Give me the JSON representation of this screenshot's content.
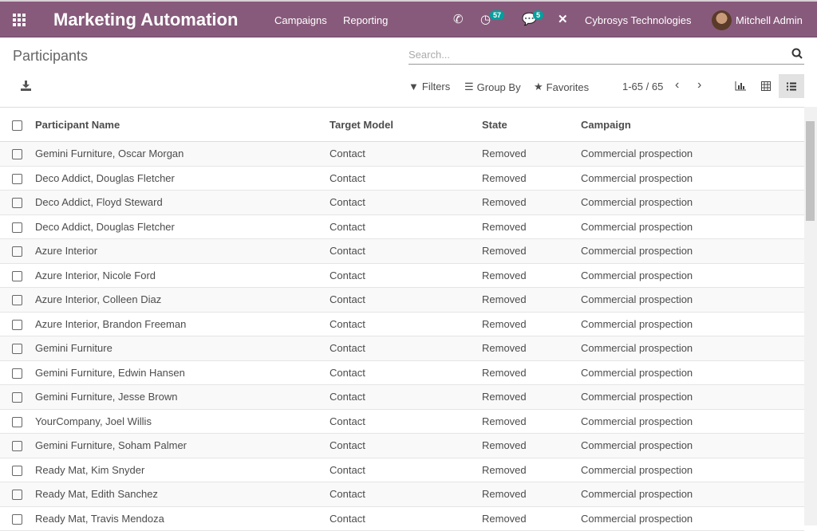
{
  "navbar": {
    "app_title": "Marketing Automation",
    "menu": [
      "Campaigns",
      "Reporting"
    ],
    "activity_count": "57",
    "message_count": "5",
    "company": "Cybrosys Technologies",
    "user": "Mitchell Admin",
    "color": "#875a7b"
  },
  "page": {
    "title": "Participants",
    "search_placeholder": "Search...",
    "filters": "Filters",
    "group_by": "Group By",
    "favorites": "Favorites",
    "pager": "1-65 / 65"
  },
  "table": {
    "headers": [
      "Participant Name",
      "Target Model",
      "State",
      "Campaign"
    ],
    "rows": [
      [
        "Gemini Furniture, Oscar Morgan",
        "Contact",
        "Removed",
        "Commercial prospection"
      ],
      [
        "Deco Addict, Douglas Fletcher",
        "Contact",
        "Removed",
        "Commercial prospection"
      ],
      [
        "Deco Addict, Floyd Steward",
        "Contact",
        "Removed",
        "Commercial prospection"
      ],
      [
        "Deco Addict, Douglas Fletcher",
        "Contact",
        "Removed",
        "Commercial prospection"
      ],
      [
        "Azure Interior",
        "Contact",
        "Removed",
        "Commercial prospection"
      ],
      [
        "Azure Interior, Nicole Ford",
        "Contact",
        "Removed",
        "Commercial prospection"
      ],
      [
        "Azure Interior, Colleen Diaz",
        "Contact",
        "Removed",
        "Commercial prospection"
      ],
      [
        "Azure Interior, Brandon Freeman",
        "Contact",
        "Removed",
        "Commercial prospection"
      ],
      [
        "Gemini Furniture",
        "Contact",
        "Removed",
        "Commercial prospection"
      ],
      [
        "Gemini Furniture, Edwin Hansen",
        "Contact",
        "Removed",
        "Commercial prospection"
      ],
      [
        "Gemini Furniture, Jesse Brown",
        "Contact",
        "Removed",
        "Commercial prospection"
      ],
      [
        "YourCompany, Joel Willis",
        "Contact",
        "Removed",
        "Commercial prospection"
      ],
      [
        "Gemini Furniture, Soham Palmer",
        "Contact",
        "Removed",
        "Commercial prospection"
      ],
      [
        "Ready Mat, Kim Snyder",
        "Contact",
        "Removed",
        "Commercial prospection"
      ],
      [
        "Ready Mat, Edith Sanchez",
        "Contact",
        "Removed",
        "Commercial prospection"
      ],
      [
        "Ready Mat, Travis Mendoza",
        "Contact",
        "Removed",
        "Commercial prospection"
      ]
    ]
  }
}
